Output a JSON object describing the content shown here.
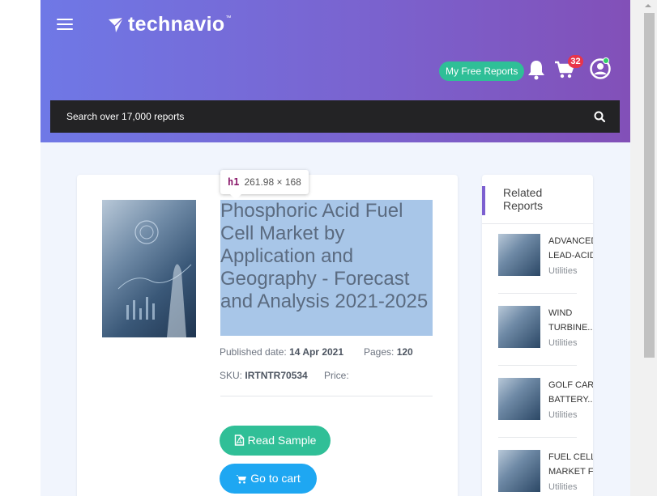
{
  "header": {
    "logo_text": "technavio",
    "logo_tm": "™",
    "free_reports_label": "My Free Reports",
    "cart_count": "32"
  },
  "search": {
    "placeholder": "Search over 17,000 reports"
  },
  "devtools_tooltip": {
    "tag": "h1",
    "size": "261.98 × 168"
  },
  "report": {
    "title": "Phosphoric Acid Fuel Cell Market by Application and Geography - Forecast and Analysis 2021-2025",
    "published_label": "Published date:",
    "published_value": "14 Apr 2021",
    "pages_label": "Pages:",
    "pages_value": "120",
    "sku_label": "SKU:",
    "sku_value": "IRTNTR70534",
    "price_label": "Price:",
    "read_sample_label": "Read Sample",
    "go_to_cart_label": "Go to cart"
  },
  "related": {
    "heading_line1": "Related",
    "heading_line2": "Reports",
    "items": [
      {
        "line1": "ADVANCED",
        "line2": "LEAD-ACID",
        "category": "Utilities"
      },
      {
        "line1": "WIND",
        "line2": "TURBINE...",
        "category": "Utilities"
      },
      {
        "line1": "GOLF CART",
        "line2": "BATTERY...",
        "category": "Utilities"
      },
      {
        "line1": "FUEL CELL",
        "line2": "MARKET F",
        "category": "Utilities"
      }
    ]
  },
  "colors": {
    "header_gradient_start": "#6f78e6",
    "header_gradient_end": "#8250b8",
    "accent_green": "#30bf97",
    "accent_blue": "#1ea7f2",
    "badge_red": "#e8344a"
  }
}
